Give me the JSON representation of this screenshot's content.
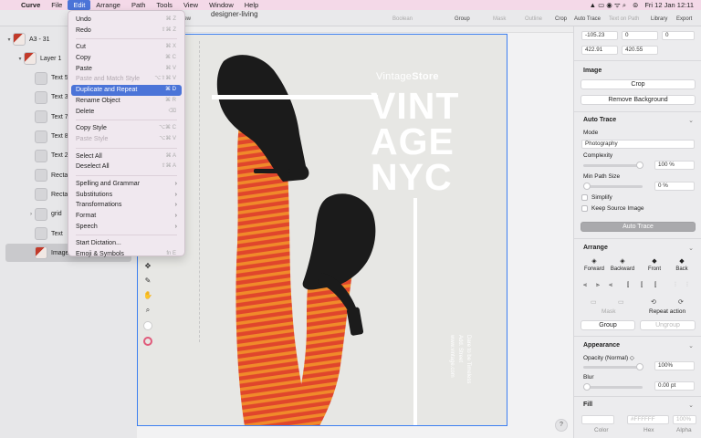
{
  "menubar": {
    "app_name": "Curve",
    "items": [
      "File",
      "Edit",
      "Arrange",
      "Path",
      "Tools",
      "View",
      "Window",
      "Help"
    ],
    "active_item": "Edit",
    "clock": "Fri 12 Jan  12:11"
  },
  "toolbar": {
    "document_title": "designer-living",
    "view_label": "iew",
    "items": [
      {
        "label": "Boolean",
        "enabled": false
      },
      {
        "label": "Group",
        "enabled": true
      },
      {
        "label": "Mask",
        "enabled": false
      },
      {
        "label": "Outline",
        "enabled": false
      },
      {
        "label": "Crop",
        "enabled": true
      },
      {
        "label": "Auto Trace",
        "enabled": true
      },
      {
        "label": "Text on Path",
        "enabled": false
      },
      {
        "label": "Library",
        "enabled": true
      },
      {
        "label": "Export",
        "enabled": true
      }
    ]
  },
  "layers": {
    "items": [
      {
        "label": "A3 - 31",
        "indent": 1,
        "caret": "▾",
        "thumb": "img"
      },
      {
        "label": "Layer 1",
        "indent": 2,
        "caret": "▾",
        "thumb": "img"
      },
      {
        "label": "Text 5",
        "indent": 3,
        "caret": "",
        "thumb": "text"
      },
      {
        "label": "Text 3",
        "indent": 3,
        "caret": "",
        "thumb": "text"
      },
      {
        "label": "Text 7",
        "indent": 3,
        "caret": "",
        "thumb": "text"
      },
      {
        "label": "Text 8",
        "indent": 3,
        "caret": "",
        "thumb": "text"
      },
      {
        "label": "Text 2",
        "indent": 3,
        "caret": "",
        "thumb": "text"
      },
      {
        "label": "Rectan",
        "indent": 3,
        "caret": "",
        "thumb": "shape"
      },
      {
        "label": "Rectan",
        "indent": 3,
        "caret": "",
        "thumb": "shape"
      },
      {
        "label": "grid",
        "indent": 3,
        "caret": "›",
        "thumb": "shape"
      },
      {
        "label": "Text",
        "indent": 3,
        "caret": "",
        "thumb": "text"
      },
      {
        "label": "Image",
        "indent": 3,
        "caret": "",
        "thumb": "img",
        "selected": true
      }
    ]
  },
  "edit_menu": {
    "items": [
      {
        "label": "Undo",
        "shortcut": "⌘ Z",
        "enabled": true
      },
      {
        "label": "Redo",
        "shortcut": "⇧⌘ Z",
        "enabled": true
      },
      {
        "sep": true
      },
      {
        "label": "Cut",
        "shortcut": "⌘ X",
        "enabled": true
      },
      {
        "label": "Copy",
        "shortcut": "⌘ C",
        "enabled": true
      },
      {
        "label": "Paste",
        "shortcut": "⌘ V",
        "enabled": true
      },
      {
        "label": "Paste and Match Style",
        "shortcut": "⌥⇧⌘ V",
        "enabled": false
      },
      {
        "label": "Duplicate and Repeat",
        "shortcut": "⌘ D",
        "enabled": true,
        "highlighted": true
      },
      {
        "label": "Rename Object",
        "shortcut": "⌘ R",
        "enabled": true
      },
      {
        "label": "Delete",
        "shortcut": "⌫",
        "enabled": true
      },
      {
        "sep": true
      },
      {
        "label": "Copy Style",
        "shortcut": "⌥⌘ C",
        "enabled": true
      },
      {
        "label": "Paste Style",
        "shortcut": "⌥⌘ V",
        "enabled": false
      },
      {
        "sep": true
      },
      {
        "label": "Select All",
        "shortcut": "⌘ A",
        "enabled": true
      },
      {
        "label": "Deselect All",
        "shortcut": "⇧⌘ A",
        "enabled": true
      },
      {
        "sep": true
      },
      {
        "label": "Spelling and Grammar",
        "submenu": true,
        "enabled": true
      },
      {
        "label": "Substitutions",
        "submenu": true,
        "enabled": true
      },
      {
        "label": "Transformations",
        "submenu": true,
        "enabled": true
      },
      {
        "label": "Format",
        "submenu": true,
        "enabled": true
      },
      {
        "label": "Speech",
        "submenu": true,
        "enabled": true
      },
      {
        "sep": true
      },
      {
        "label": "Start Dictation...",
        "shortcut": "",
        "enabled": true
      },
      {
        "label": "Emoji & Symbols",
        "shortcut": "fn E",
        "enabled": true
      }
    ]
  },
  "poster": {
    "brand_light": "Vintage",
    "brand_bold": "Store",
    "headline": [
      "VINT",
      "AGE",
      "NYC"
    ],
    "side_text": [
      "Dare to be Timeless",
      "Add. Street",
      "www.vintage.com"
    ]
  },
  "inspector": {
    "position": {
      "x": "-105.23",
      "y": "0",
      "z": "0"
    },
    "size": {
      "w": "422.91",
      "h": "420.55"
    },
    "image": {
      "title": "Image",
      "crop": "Crop",
      "remove_bg": "Remove Background"
    },
    "auto_trace": {
      "title": "Auto Trace",
      "mode_label": "Mode",
      "mode_value": "Photography",
      "complexity_label": "Complexity",
      "complexity_value": "100 %",
      "min_path_label": "Min Path Size",
      "min_path_value": "0 %",
      "simplify": "Simplify",
      "keep_source": "Keep Source Image",
      "button": "Auto Trace"
    },
    "arrange": {
      "title": "Arrange",
      "forward": "Forward",
      "backward": "Backward",
      "front": "Front",
      "back": "Back",
      "mask": "Mask",
      "repeat": "Repeat action",
      "group": "Group",
      "ungroup": "Ungroup"
    },
    "appearance": {
      "title": "Appearance",
      "opacity_label": "Opacity (Normal) ◇",
      "opacity_value": "100%",
      "blur_label": "Blur",
      "blur_value": "0.00 pt"
    },
    "fill": {
      "title": "Fill",
      "hex": "#FFFFFF",
      "alpha": "100%",
      "color_label": "Color",
      "hex_label": "Hex",
      "alpha_label": "Alpha"
    }
  },
  "colors": {
    "accent": "#4b74d8",
    "selection": "#3d7ff0",
    "tights_red": "#e0462c",
    "tights_orange": "#f08a2a",
    "shoe": "#1b1b1b"
  }
}
